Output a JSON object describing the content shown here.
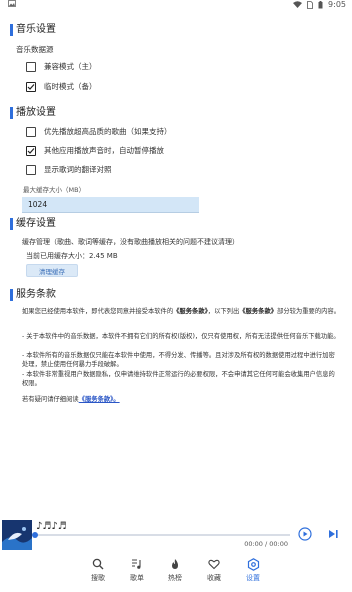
{
  "status": {
    "time": "9:05",
    "colors": {
      "icon": "#555555"
    }
  },
  "music": {
    "title": "音乐设置",
    "source_label": "音乐数据源",
    "options": [
      {
        "label": "兼容模式（主）",
        "checked": false
      },
      {
        "label": "临时模式（备）",
        "checked": true
      }
    ]
  },
  "playback": {
    "title": "播放设置",
    "options": [
      {
        "label": "优先播放超高品质的歌曲（如果支持）",
        "checked": false
      },
      {
        "label": "其他应用播放声音时，自动暂停播放",
        "checked": true
      },
      {
        "label": "显示歌词的翻译对照",
        "checked": false
      }
    ],
    "cache_label": "最大缓存大小（MB）",
    "cache_value": "1024"
  },
  "cache": {
    "title": "缓存设置",
    "desc": "缓存管理（歌曲、歌词等缓存，没有歌曲播放相关的问题不建议清理）",
    "current": "当前已用缓存大小：2.45 MB",
    "clear_button": "清理缓存"
  },
  "terms": {
    "title": "服务条款",
    "p1_a": "如果您已经使用本软件，即代表您同意并接受本软件的",
    "p1_b": "《服务条款》",
    "p1_c": "，以下列出",
    "p1_d": "《服务条款》",
    "p1_e": "部分较为重要的内容。",
    "items": [
      "- 关于本软件中的音乐数据，本软件不拥有它们的所有权(版权)，仅只有使用权，所有无法提供任何音乐下载功能。",
      "- 本软件所有的音乐数据仅只能在本软件中使用，不得分发、传播等。且对涉及所有权的数据使用过程中进行加密处理，禁止使用任何暴力手段破解。",
      "- 本软件非常重视用户数据隐私，仅申请维持软件正常运行的必要权限，不会申请其它任何可能会收集用户信息的权限。"
    ],
    "footer_a": "若有疑问请仔细阅读",
    "footer_link": "《服务条款》。"
  },
  "player": {
    "song_title": "♪♬♪♬",
    "time": "00:00 / 00:00",
    "accent": "#2f6fdc"
  },
  "nav": {
    "items": [
      {
        "label": "搜歌",
        "icon": "search-icon",
        "active": false
      },
      {
        "label": "歌单",
        "icon": "playlist-icon",
        "active": false
      },
      {
        "label": "热榜",
        "icon": "fire-icon",
        "active": false
      },
      {
        "label": "收藏",
        "icon": "heart-icon",
        "active": false
      },
      {
        "label": "设置",
        "icon": "settings-icon",
        "active": true
      }
    ]
  }
}
